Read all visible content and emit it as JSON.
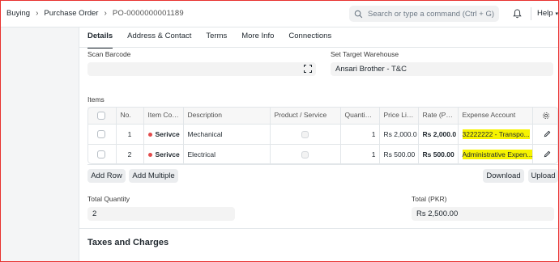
{
  "navbar": {
    "breadcrumbs": [
      "Buying",
      "Purchase Order",
      "PO-0000000001189"
    ],
    "search_placeholder": "Search or type a command (Ctrl + G)",
    "help_label": "Help"
  },
  "tabs": [
    "Details",
    "Address & Contact",
    "Terms",
    "More Info",
    "Connections"
  ],
  "active_tab": "Details",
  "scan_barcode": {
    "label": "Scan Barcode",
    "value": ""
  },
  "set_target_warehouse": {
    "label": "Set Target Warehouse",
    "value": "Ansari Brother - T&C"
  },
  "items": {
    "section_label": "Items",
    "columns": [
      "No.",
      "Item Co…",
      "Description",
      "Product / Service",
      "Quanti…",
      "Price Li…",
      "Rate (P…",
      "Expense Account"
    ],
    "rows": [
      {
        "no": "1",
        "item_code": "Serivce",
        "description": "Mechanical",
        "quantity": "1",
        "price_list": "Rs 2,000.0",
        "rate": "Rs 2,000.0",
        "expense_account": "32222222 - Transpo..."
      },
      {
        "no": "2",
        "item_code": "Serivce",
        "description": "Electrical",
        "quantity": "1",
        "price_list": "Rs 500.00",
        "rate": "Rs 500.00",
        "expense_account": "Administrative Expen..."
      }
    ],
    "status_dot_color": "#e24c4c",
    "highlight_color": "#f6f300"
  },
  "buttons": {
    "add_row": "Add Row",
    "add_multiple": "Add Multiple",
    "download": "Download",
    "upload": "Upload"
  },
  "total_quantity": {
    "label": "Total Quantity",
    "value": "2"
  },
  "total_pkr": {
    "label": "Total (PKR)",
    "value": "Rs 2,500.00"
  },
  "taxes_section": {
    "title": "Taxes and Charges"
  },
  "icons": [
    "search-icon",
    "bell-icon",
    "chevron-down-icon",
    "barcode-scan-icon",
    "gear-icon",
    "pencil-icon"
  ]
}
